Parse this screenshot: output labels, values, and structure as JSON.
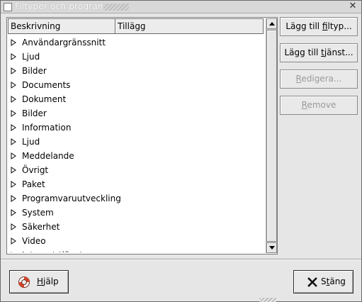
{
  "window": {
    "title": "Filtyper och program"
  },
  "list": {
    "columns": [
      "Beskrivning",
      "Tillägg"
    ],
    "rows": [
      "Användargränssnitt",
      "Ljud",
      "Bilder",
      "Documents",
      "Dokument",
      "Bilder",
      "Information",
      "Ljud",
      "Meddelande",
      "Övrigt",
      "Paket",
      "Programvaruutveckling",
      "System",
      "Säkerhet",
      "Video",
      "Internet-tjänster"
    ]
  },
  "side_buttons": {
    "add_filetype": {
      "pre": "Lägg till ",
      "u": "f",
      "post": "iltyp..."
    },
    "add_service": {
      "pre": "Lägg till ",
      "u": "t",
      "post": "jänst..."
    },
    "edit": {
      "pre": "",
      "u": "R",
      "post": "edigera..."
    },
    "remove": {
      "pre": "",
      "u": "R",
      "post": "emove"
    }
  },
  "bottom_buttons": {
    "help": {
      "u": "H",
      "post": "jälp"
    },
    "close": {
      "pre": "S",
      "u": "t",
      "post": "äng"
    }
  },
  "icons": {
    "row_expander": "triangle-right-icon",
    "help": "lifebuoy-icon",
    "close": "x-close-icon"
  }
}
